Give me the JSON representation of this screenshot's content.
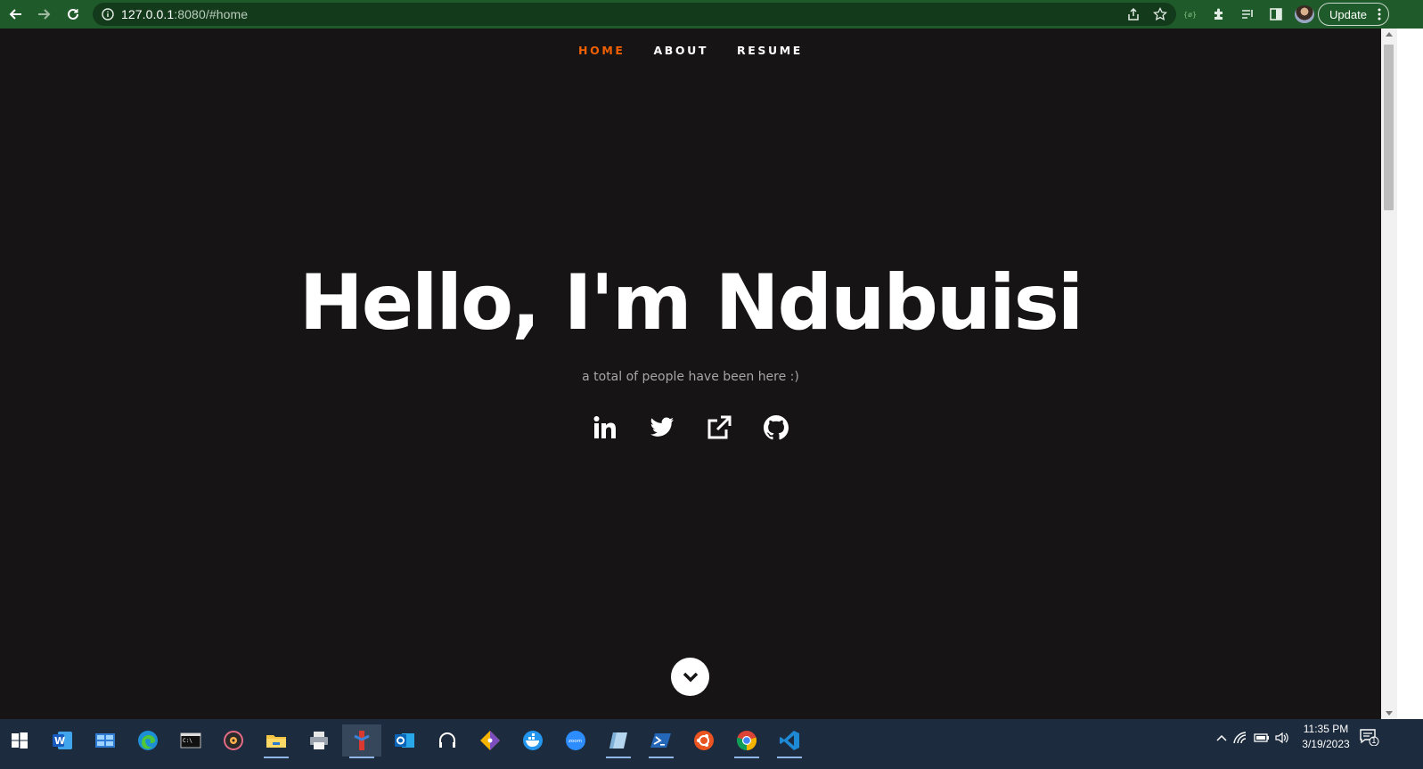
{
  "browser": {
    "url_host": "127.0.0.1",
    "url_rest": ":8080/#home",
    "update_label": "Update"
  },
  "nav": {
    "items": [
      {
        "label": "HOME",
        "active": true
      },
      {
        "label": "ABOUT",
        "active": false
      },
      {
        "label": "RESUME",
        "active": false
      }
    ],
    "active_color": "#f06000"
  },
  "hero": {
    "title": "Hello, I'm Ndubuisi",
    "subtitle": "a total of people have been here :)"
  },
  "socials": [
    "linkedin-icon",
    "twitter-icon",
    "external-link-icon",
    "github-icon"
  ],
  "taskbar": {
    "time": "11:35 PM",
    "date": "3/19/2023",
    "notification_count": "1",
    "apps": [
      "windows-start-icon",
      "word-icon",
      "control-panel-icon",
      "edge-icon",
      "terminal-icon",
      "media-player-icon",
      "file-explorer-icon",
      "printer-icon",
      "app-pinned-icon",
      "outlook-icon",
      "headset-icon",
      "git-icon",
      "docker-icon",
      "zoom-icon",
      "notebook-icon",
      "powershell-icon",
      "ubuntu-icon",
      "chrome-icon",
      "vscode-icon"
    ]
  },
  "colors": {
    "chrome_bar": "#1f5a2a",
    "page_bg": "#161415",
    "taskbar": "#1c2b3d"
  }
}
